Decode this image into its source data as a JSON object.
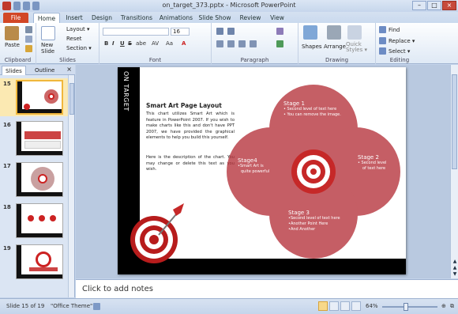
{
  "window": {
    "title": "on_target_373.pptx - Microsoft PowerPoint"
  },
  "tabs": [
    "File",
    "Home",
    "Insert",
    "Design",
    "Transitions",
    "Animations",
    "Slide Show",
    "Review",
    "View"
  ],
  "ribbon": {
    "clipboard": {
      "label": "Clipboard",
      "paste": "Paste"
    },
    "slides": {
      "label": "Slides",
      "new_slide": "New\nSlide",
      "layout": "Layout ▾",
      "reset": "Reset",
      "section": "Section ▾"
    },
    "font": {
      "label": "Font",
      "size": "16",
      "bold": "B",
      "italic": "I",
      "underline": "U",
      "strike": "S",
      "shadow": "abe",
      "spacing": "AV",
      "case": "Aa",
      "color": "A"
    },
    "paragraph": {
      "label": "Paragraph"
    },
    "drawing": {
      "label": "Drawing",
      "shapes": "Shapes",
      "arrange": "Arrange",
      "quick_styles": "Quick\nStyles ▾"
    },
    "editing": {
      "label": "Editing",
      "find": "Find",
      "replace": "Replace ▾",
      "select": "Select ▾"
    }
  },
  "panel": {
    "tab_slides": "Slides",
    "tab_outline": "Outline",
    "close": "×",
    "thumbs": [
      {
        "num": "15"
      },
      {
        "num": "16"
      },
      {
        "num": "17"
      },
      {
        "num": "18"
      },
      {
        "num": "19"
      }
    ]
  },
  "slide": {
    "vertical_title": "ON TARGET",
    "heading": "Smart Art Page Layout",
    "para1": "This chart utilizes Smart Art which is feature in PowerPoint 2007.  If you wish to make charts like this and don't have PPT 2007, we have provided the graphical elements to help you build this yourself.",
    "para2": "Here is the description of the chart. You may change or delete this text as you wish.",
    "stage1": {
      "title": "Stage 1",
      "lines": [
        "• Second level of text here",
        "• You can remove the image."
      ]
    },
    "stage2": {
      "title": "Stage 2",
      "lines": [
        "• Second level",
        "of text here"
      ]
    },
    "stage3": {
      "title": "Stage 3",
      "lines": [
        "•Second level of text here",
        "•Another Point Here",
        "•And Another"
      ]
    },
    "stage4": {
      "title": "Stage4",
      "lines": [
        "•Smart Art is",
        "quite powerful"
      ]
    }
  },
  "notes": {
    "placeholder": "Click to add notes"
  },
  "status": {
    "slide": "Slide 15 of 19",
    "theme": "\"Office Theme\"",
    "zoom": "64%"
  },
  "colors": {
    "accent": "#b5323a",
    "light": "#d79092",
    "ribbon": "#dfe9f5"
  }
}
